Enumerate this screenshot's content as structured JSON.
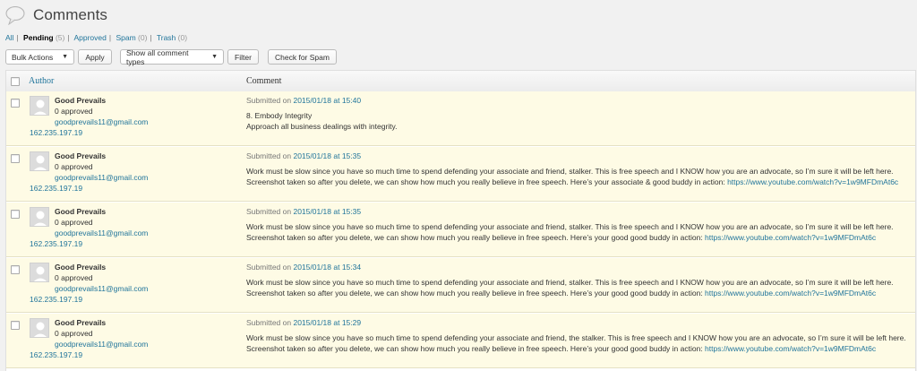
{
  "page": {
    "title": "Comments"
  },
  "subsub": [
    {
      "label": "All",
      "count": "",
      "current": false
    },
    {
      "label": "Pending",
      "count": "(5)",
      "current": true
    },
    {
      "label": "Approved",
      "count": "",
      "current": false
    },
    {
      "label": "Spam",
      "count": "(0)",
      "current": false
    },
    {
      "label": "Trash",
      "count": "(0)",
      "current": false
    }
  ],
  "toolbar": {
    "bulk_actions": "Bulk Actions",
    "apply": "Apply",
    "comment_types": "Show all comment types",
    "filter": "Filter",
    "check_spam": "Check for Spam"
  },
  "table": {
    "col_author": "Author",
    "col_comment": "Comment",
    "submitted_prefix": "Submitted on",
    "rows": [
      {
        "author": "Good Prevails",
        "approved": "0 approved",
        "email": "goodprevails11@gmail.com",
        "ip": "162.235.197.19",
        "date": "2015/01/18 at 15:40",
        "lines": [
          "8. Embody Integrity",
          "Approach all business dealings with integrity."
        ],
        "link": ""
      },
      {
        "author": "Good Prevails",
        "approved": "0 approved",
        "email": "goodprevails11@gmail.com",
        "ip": "162.235.197.19",
        "date": "2015/01/18 at 15:35",
        "lines": [
          "Work must be slow since you have so much time to spend defending your associate and friend, stalker. This is free speech and I KNOW how you are an advocate, so I’m sure it will be left here.",
          "Screenshot taken so after you delete, we can show how much you really believe in free speech. Here’s your associate & good buddy in action: "
        ],
        "link": "https://www.youtube.com/watch?v=1w9MFDmAt6c"
      },
      {
        "author": "Good Prevails",
        "approved": "0 approved",
        "email": "goodprevails11@gmail.com",
        "ip": "162.235.197.19",
        "date": "2015/01/18 at 15:35",
        "lines": [
          "Work must be slow since you have so much time to spend defending your associate and friend, stalker. This is free speech and I KNOW how you are an advocate, so I’m sure it will be left here.",
          "Screenshot taken so after you delete, we can show how much you really believe in free speech. Here’s your good good buddy in action: "
        ],
        "link": "https://www.youtube.com/watch?v=1w9MFDmAt6c"
      },
      {
        "author": "Good Prevails",
        "approved": "0 approved",
        "email": "goodprevails11@gmail.com",
        "ip": "162.235.197.19",
        "date": "2015/01/18 at 15:34",
        "lines": [
          "Work must be slow since you have so much time to spend defending your associate and friend, stalker. This is free speech and I KNOW how you are an advocate, so I’m sure it will be left here.",
          "Screenshot taken so after you delete, we can show how much you really believe in free speech. Here’s your good good buddy in action: "
        ],
        "link": "https://www.youtube.com/watch?v=1w9MFDmAt6c"
      },
      {
        "author": "Good Prevails",
        "approved": "0 approved",
        "email": "goodprevails11@gmail.com",
        "ip": "162.235.197.19",
        "date": "2015/01/18 at 15:29",
        "lines": [
          "Work must be slow since you have so much time to spend defending your associate and friend, the stalker. This is free speech and I KNOW how you are an advocate, so I’m sure it will be left here.",
          "Screenshot taken so after you delete, we can show how much you really believe in free speech. Here’s your good good buddy in action: "
        ],
        "link": "https://www.youtube.com/watch?v=1w9MFDmAt6c"
      }
    ]
  }
}
